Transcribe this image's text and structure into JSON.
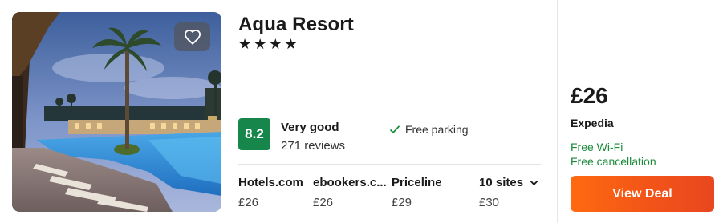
{
  "hotel": {
    "name": "Aqua Resort",
    "stars": 4,
    "star_glyph": "★",
    "favorite_icon": "heart-icon"
  },
  "rating": {
    "score": "8.2",
    "label": "Very good",
    "reviews": "271 reviews",
    "badge_color": "#16864a"
  },
  "amenity": {
    "icon": "check-icon",
    "label": "Free parking"
  },
  "sites": [
    {
      "name": "Hotels.com",
      "price": "£26"
    },
    {
      "name": "ebookers.c...",
      "price": "£26"
    },
    {
      "name": "Priceline",
      "price": "£29"
    }
  ],
  "more_sites": {
    "label": "10 sites",
    "icon": "chevron-down-icon",
    "price": "£30"
  },
  "deal": {
    "price": "£26",
    "site": "Expedia",
    "perks": [
      "Free Wi-Fi",
      "Free cancellation"
    ],
    "perk_color": "#1b8a3b",
    "button_label": "View Deal",
    "button_color": "#f25418"
  }
}
